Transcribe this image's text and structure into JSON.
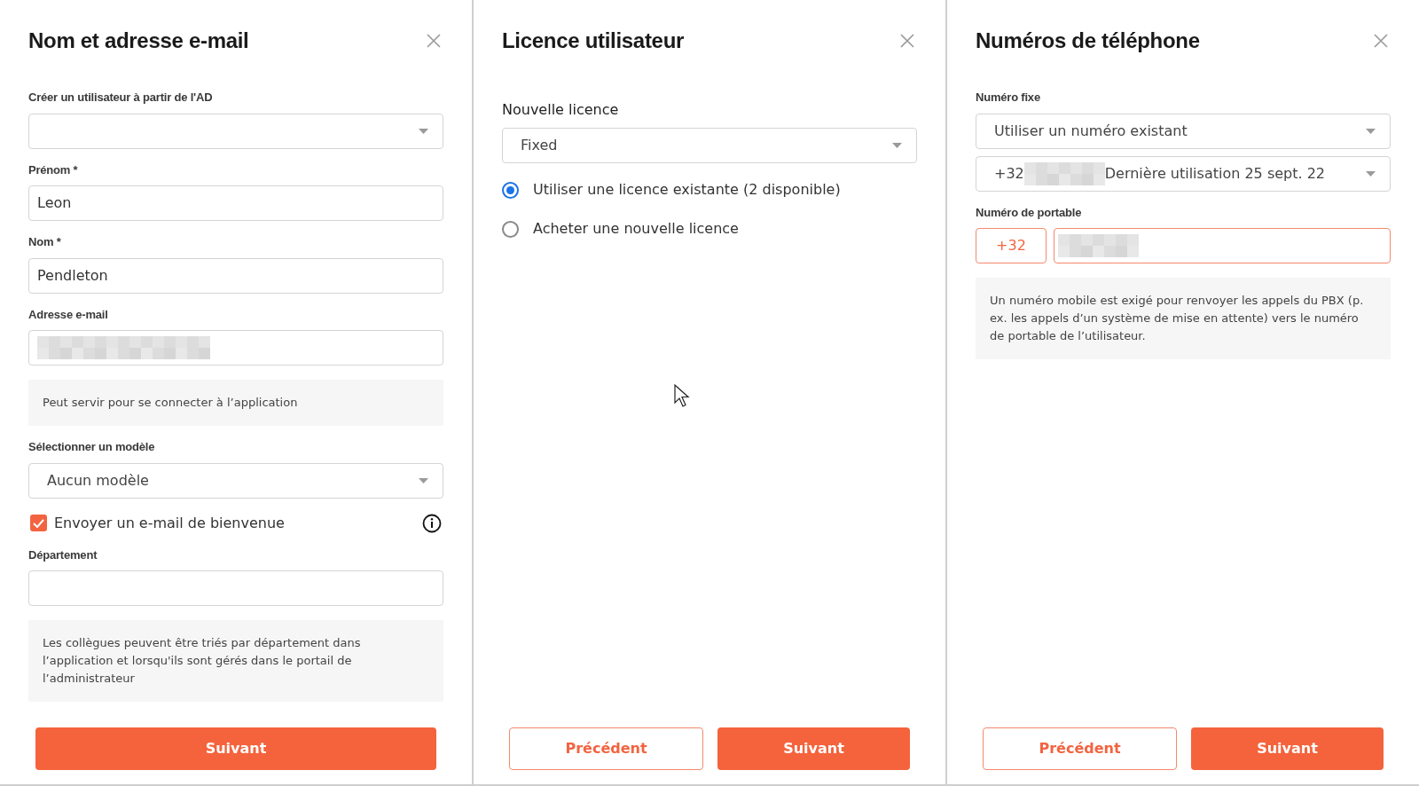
{
  "name_email": {
    "title": "Nom et adresse e-mail",
    "fields": [
      {
        "kind": "select",
        "label": "Créer un utilisateur à partir de l'AD"
      },
      {
        "kind": "input",
        "label": "Prénom *",
        "value": "Leon"
      },
      {
        "kind": "input",
        "label": "Nom *",
        "value": "Pendleton"
      },
      {
        "kind": "input",
        "label": "Adresse e-mail",
        "redacted": true
      },
      {
        "kind": "note",
        "text": "Peut servir pour se connecter à l’application"
      },
      {
        "kind": "select",
        "label": "Sélectionner un modèle",
        "value": "Aucun modèle"
      },
      {
        "kind": "checkbox",
        "label": "Envoyer un e-mail de bienvenue",
        "checked": true
      },
      {
        "kind": "input",
        "label": "Département"
      },
      {
        "kind": "note",
        "text": "Les collègues peuvent être triés par département dans l’application et lorsqu'ils sont gérés dans le portail de l’administrateur"
      }
    ],
    "buttons": [
      {
        "kind": "primary",
        "label": "Suivant"
      }
    ]
  },
  "license": {
    "title": "Licence utilisateur",
    "label": "Nouvelle licence",
    "value": "Fixed",
    "options": [
      {
        "label": "Utiliser une licence existante (2 disponible)",
        "selected": true
      },
      {
        "label": "Acheter une nouvelle licence",
        "selected": false
      }
    ],
    "buttons": [
      {
        "kind": "secondary",
        "label": "Précédent"
      },
      {
        "kind": "primary",
        "label": "Suivant"
      }
    ]
  },
  "phone": {
    "title": "Numéros de téléphone",
    "fields": [
      {
        "kind": "select",
        "label": "Numéro fixe",
        "value": "Utiliser un numéro existant"
      },
      {
        "kind": "select",
        "prefix": "+32",
        "redacted": true,
        "value": "Dernière utilisation 25 sept. 22"
      },
      {
        "kind": "phone",
        "label": "Numéro de portable",
        "prefix": "+32",
        "redacted": true
      },
      {
        "kind": "note",
        "text": "Un numéro mobile est exigé pour renvoyer les appels du PBX (p. ex. les appels d’un système de mise en attente) vers le numéro de portable de l’utilisateur."
      }
    ],
    "buttons": [
      {
        "kind": "secondary",
        "label": "Précédent"
      },
      {
        "kind": "primary",
        "label": "Suivant"
      }
    ]
  }
}
